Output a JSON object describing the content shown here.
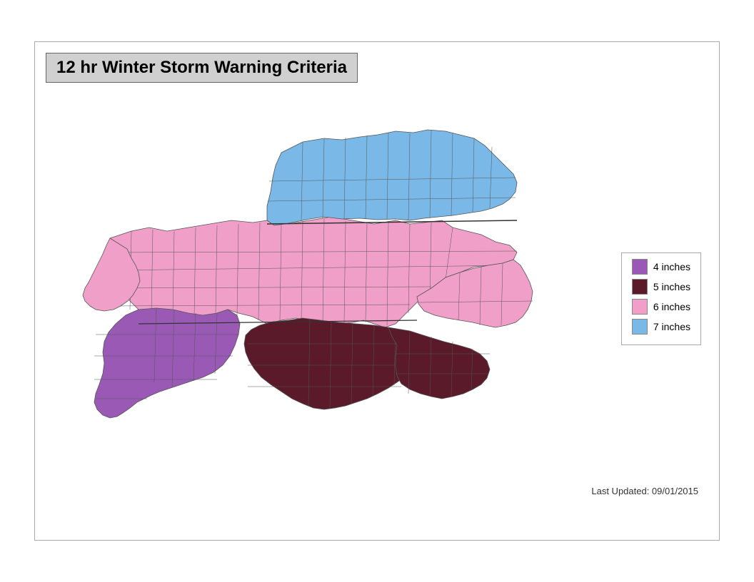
{
  "title": "12 hr Winter Storm Warning Criteria",
  "legend": {
    "items": [
      {
        "label": "4 inches",
        "color": "#9b59b6"
      },
      {
        "label": "5 inches",
        "color": "#5a1a2a"
      },
      {
        "label": "6 inches",
        "color": "#f0a0c8"
      },
      {
        "label": "7 inches",
        "color": "#7ab8e8"
      }
    ]
  },
  "last_updated_label": "Last Updated:  09/01/2015",
  "map": {
    "colors": {
      "purple": "#9b59b6",
      "dark_maroon": "#5a1a2a",
      "pink": "#f0a0c8",
      "blue": "#7ab8e8",
      "stroke": "#555",
      "background": "#ffffff"
    }
  }
}
